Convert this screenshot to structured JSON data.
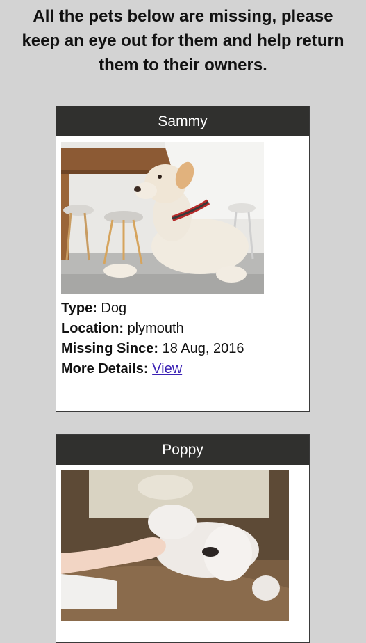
{
  "intro": {
    "line1": "All the pets below are missing, please",
    "line2": "keep an eye out for them and help return",
    "line3": "them to their owners."
  },
  "pets": [
    {
      "name": "Sammy",
      "image_desc": "dog-photo",
      "type_label": "Type:",
      "type": "Dog",
      "location_label": "Location:",
      "location": "plymouth",
      "missing_label": "Missing Since:",
      "missing_since": "18 Aug, 2016",
      "details_label": "More Details:",
      "details_link": "View"
    },
    {
      "name": "Poppy",
      "image_desc": "dog-photo"
    }
  ],
  "colors": {
    "page_bg": "#d3d3d3",
    "card_header_bg": "#30302e",
    "link": "#3a21b4"
  }
}
